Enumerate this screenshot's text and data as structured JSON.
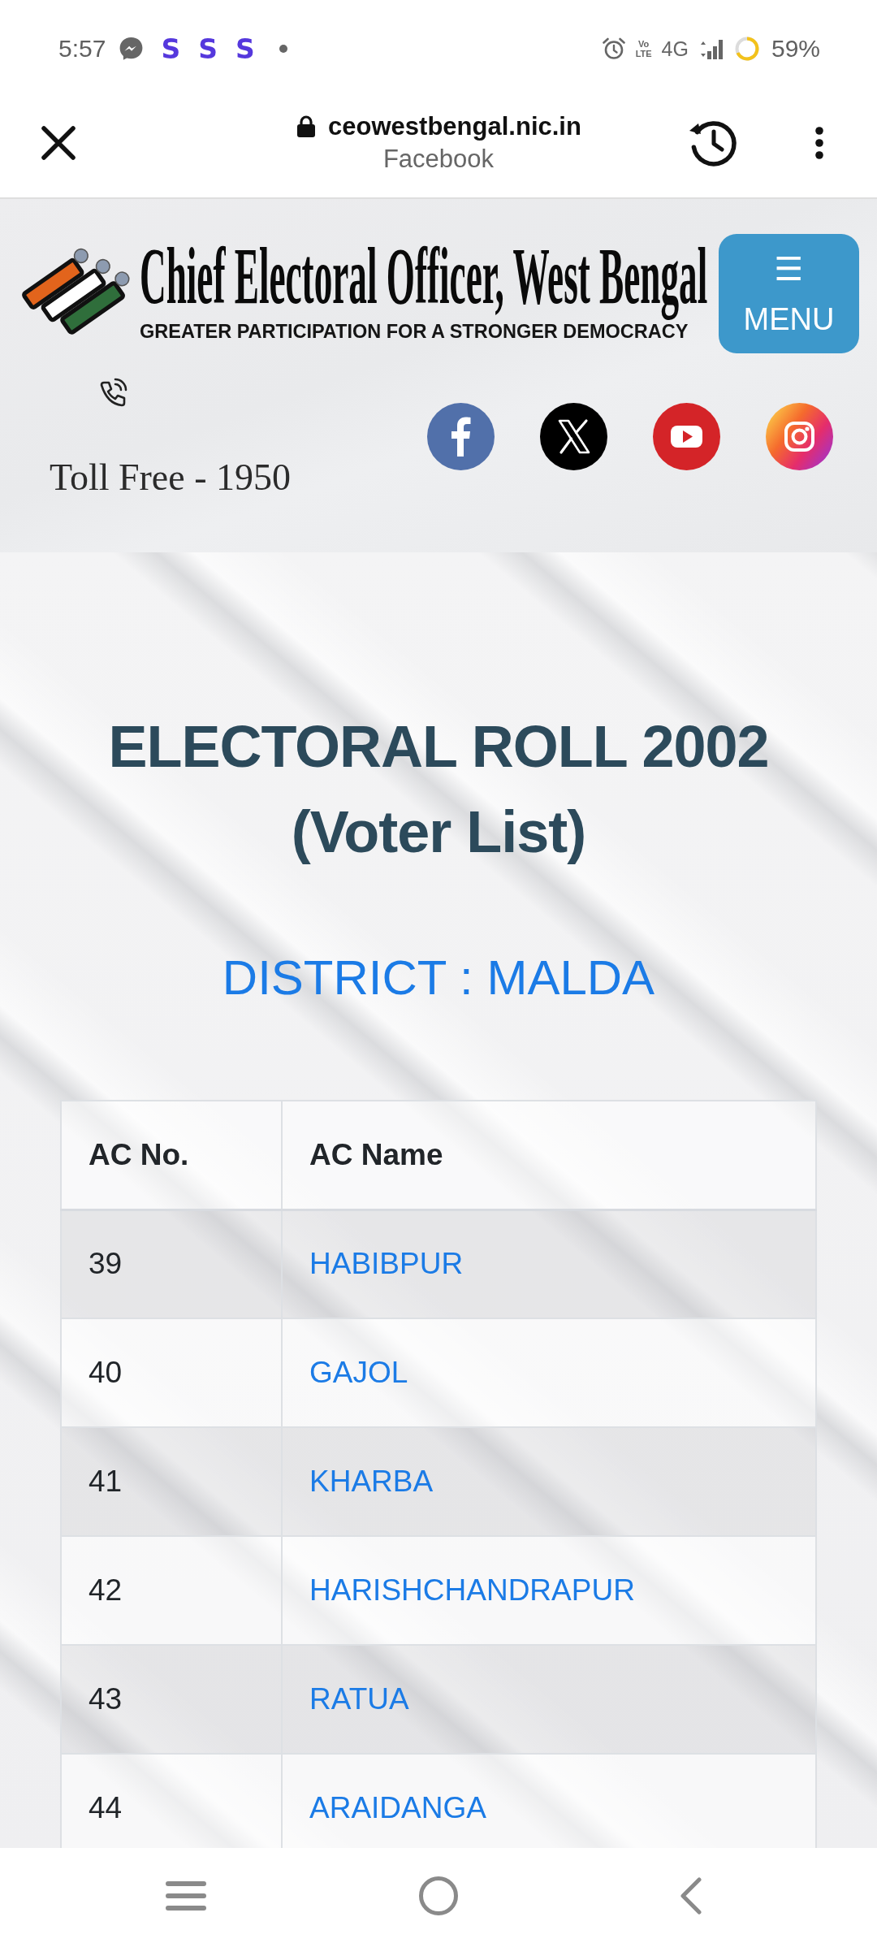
{
  "status_bar": {
    "time": "5:57",
    "app_icons": [
      "S",
      "S",
      "S"
    ],
    "volte": [
      "Vo",
      "LTE"
    ],
    "network": "4G",
    "battery": "59%"
  },
  "browser_bar": {
    "url": "ceowestbengal.nic.in",
    "referrer": "Facebook"
  },
  "header": {
    "title": "Chief Electoral Officer, West Bengal",
    "tagline": "GREATER PARTICIPATION FOR A STRONGER DEMOCRACY",
    "menu_button": {
      "icon": "☰",
      "label": "MENU"
    },
    "toll_free": "Toll Free - 1950"
  },
  "page": {
    "title": "ELECTORAL ROLL 2002 (Voter List)",
    "district": "DISTRICT : MALDA"
  },
  "table": {
    "columns": [
      "AC No.",
      "AC Name"
    ],
    "rows": [
      {
        "ac_no": "39",
        "ac_name": "HABIBPUR"
      },
      {
        "ac_no": "40",
        "ac_name": "GAJOL"
      },
      {
        "ac_no": "41",
        "ac_name": "KHARBA"
      },
      {
        "ac_no": "42",
        "ac_name": "HARISHCHANDRAPUR"
      },
      {
        "ac_no": "43",
        "ac_name": "RATUA"
      },
      {
        "ac_no": "44",
        "ac_name": "ARAIDANGA"
      }
    ]
  }
}
